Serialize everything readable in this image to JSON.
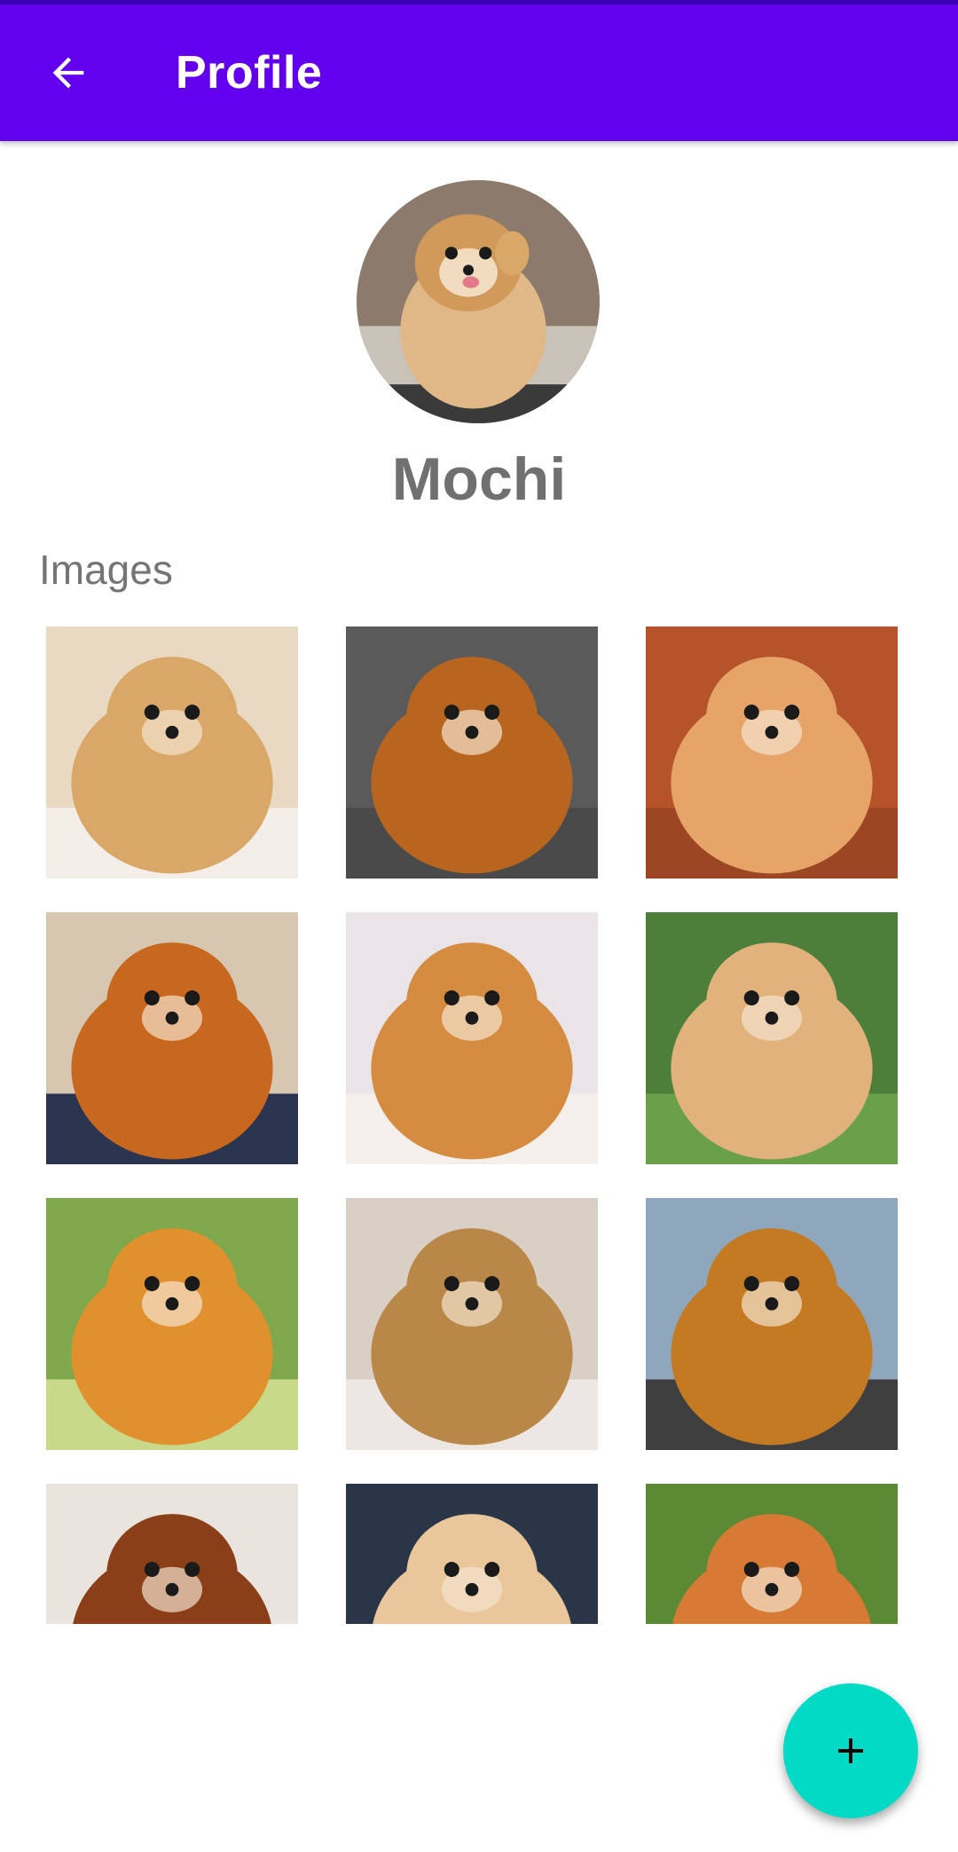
{
  "app_bar": {
    "title": "Profile",
    "back_icon": "arrow-back-icon",
    "color": "#6200ee"
  },
  "profile": {
    "name": "Mochi",
    "avatar": "pomeranian-waving-photo"
  },
  "images_section": {
    "label": "Images",
    "photos": [
      {
        "name": "photo-pom-waving",
        "bg": "#e9d9c2",
        "fur": "#d9a868",
        "ground": "#f3efe8"
      },
      {
        "name": "photo-pom-with-toy",
        "bg": "#5a5a5a",
        "fur": "#b8651f",
        "ground": "#4a4a4a"
      },
      {
        "name": "photo-pom-standing-floor",
        "bg": "#b5532a",
        "fur": "#e6a468",
        "ground": "#9c4624"
      },
      {
        "name": "photo-pom-in-basket",
        "bg": "#d8c7b0",
        "fur": "#c8671e",
        "ground": "#2b3550"
      },
      {
        "name": "photo-pom-tongue-out",
        "bg": "#e8e4e8",
        "fur": "#d58c40",
        "ground": "#f4efea"
      },
      {
        "name": "photo-pom-on-grass-flowers",
        "bg": "#4e7f3a",
        "fur": "#e2b27c",
        "ground": "#6aa04a"
      },
      {
        "name": "photo-pom-garden",
        "bg": "#7fa84d",
        "fur": "#e1902e",
        "ground": "#c9d98a"
      },
      {
        "name": "photo-pom-on-bed",
        "bg": "#d9cfc4",
        "fur": "#b98748",
        "ground": "#ece7e2"
      },
      {
        "name": "photo-pom-grooming",
        "bg": "#8fa7bd",
        "fur": "#c47a22",
        "ground": "#3f3f3f"
      },
      {
        "name": "photo-pom-harness",
        "bg": "#e9e4de",
        "fur": "#8a3f18",
        "ground": "#dcd4ca"
      },
      {
        "name": "photo-two-poms-car",
        "bg": "#2a3548",
        "fur": "#e9c79a",
        "ground": "#3d4a60"
      },
      {
        "name": "photo-pom-bushes",
        "bg": "#5c8a34",
        "fur": "#d77a36",
        "ground": "#3f6a26"
      }
    ]
  },
  "fab": {
    "icon": "plus-icon",
    "color": "#03dac5"
  }
}
